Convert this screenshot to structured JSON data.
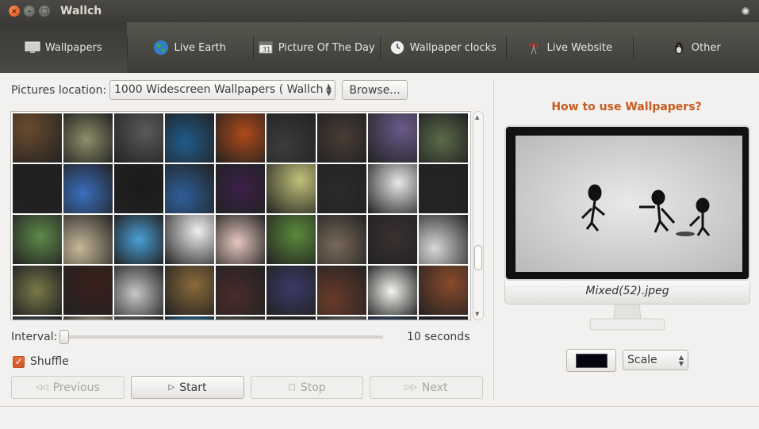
{
  "window": {
    "title": "Wallch"
  },
  "tabs": [
    {
      "label": "Wallpapers",
      "icon": "monitor-icon"
    },
    {
      "label": "Live Earth",
      "icon": "globe-icon"
    },
    {
      "label": "Picture Of The Day",
      "icon": "calendar-icon"
    },
    {
      "label": "Wallpaper clocks",
      "icon": "clock-icon"
    },
    {
      "label": "Live Website",
      "icon": "broadcast-icon"
    },
    {
      "label": "Other",
      "icon": "penguin-icon"
    }
  ],
  "wallpapers": {
    "location_label": "Pictures location:",
    "location_value": "1000 Widescreen Wallpapers ( Wallch )",
    "browse_label": "Browse...",
    "interval_label": "Interval:",
    "interval_value": "10 seconds",
    "interval_slider_fraction": 0,
    "shuffle_label": "Shuffle",
    "shuffle_checked": true,
    "previous_label": "Previous",
    "start_label": "Start",
    "stop_label": "Stop",
    "next_label": "Next",
    "thumbnail_colors": [
      "#6b4b2e",
      "#8e8e6a",
      "#5a5a5a",
      "#1f5c8c",
      "#b04a18",
      "#3c3c3c",
      "#4a3c34",
      "#6a5a8a",
      "#5b6b4a",
      "#1f1f1f",
      "#3a6fbf",
      "#1a1a1a",
      "#2d5f9a",
      "#3c1f4a",
      "#c0c078",
      "#2b2b2b",
      "#e8e8e8",
      "#242424",
      "#5e8a4a",
      "#c8b89a",
      "#4aa0d8",
      "#f0f0f0",
      "#e8c8c0",
      "#5a8a3a",
      "#7a6a5a",
      "#3a3030",
      "#d8d8d8",
      "#7a7a4a",
      "#3a1f1a",
      "#c8c8c8",
      "#8a6a3a",
      "#4a2a2a",
      "#3a3a6a",
      "#6a3a2a",
      "#f4f4f0",
      "#8a4a2a",
      "#5a6a7a",
      "#c8b0a0",
      "#a0a0a0",
      "#2a9ad8",
      "#4a4a4a",
      "#2a2a2a",
      "#6a6a6a",
      "#3a6aaa",
      "#1a1a2a"
    ]
  },
  "preview": {
    "help_link": "How to use Wallpapers?",
    "filename": "Mixed(52).jpeg",
    "mode_value": "Scale",
    "bg_color": "#050512"
  }
}
